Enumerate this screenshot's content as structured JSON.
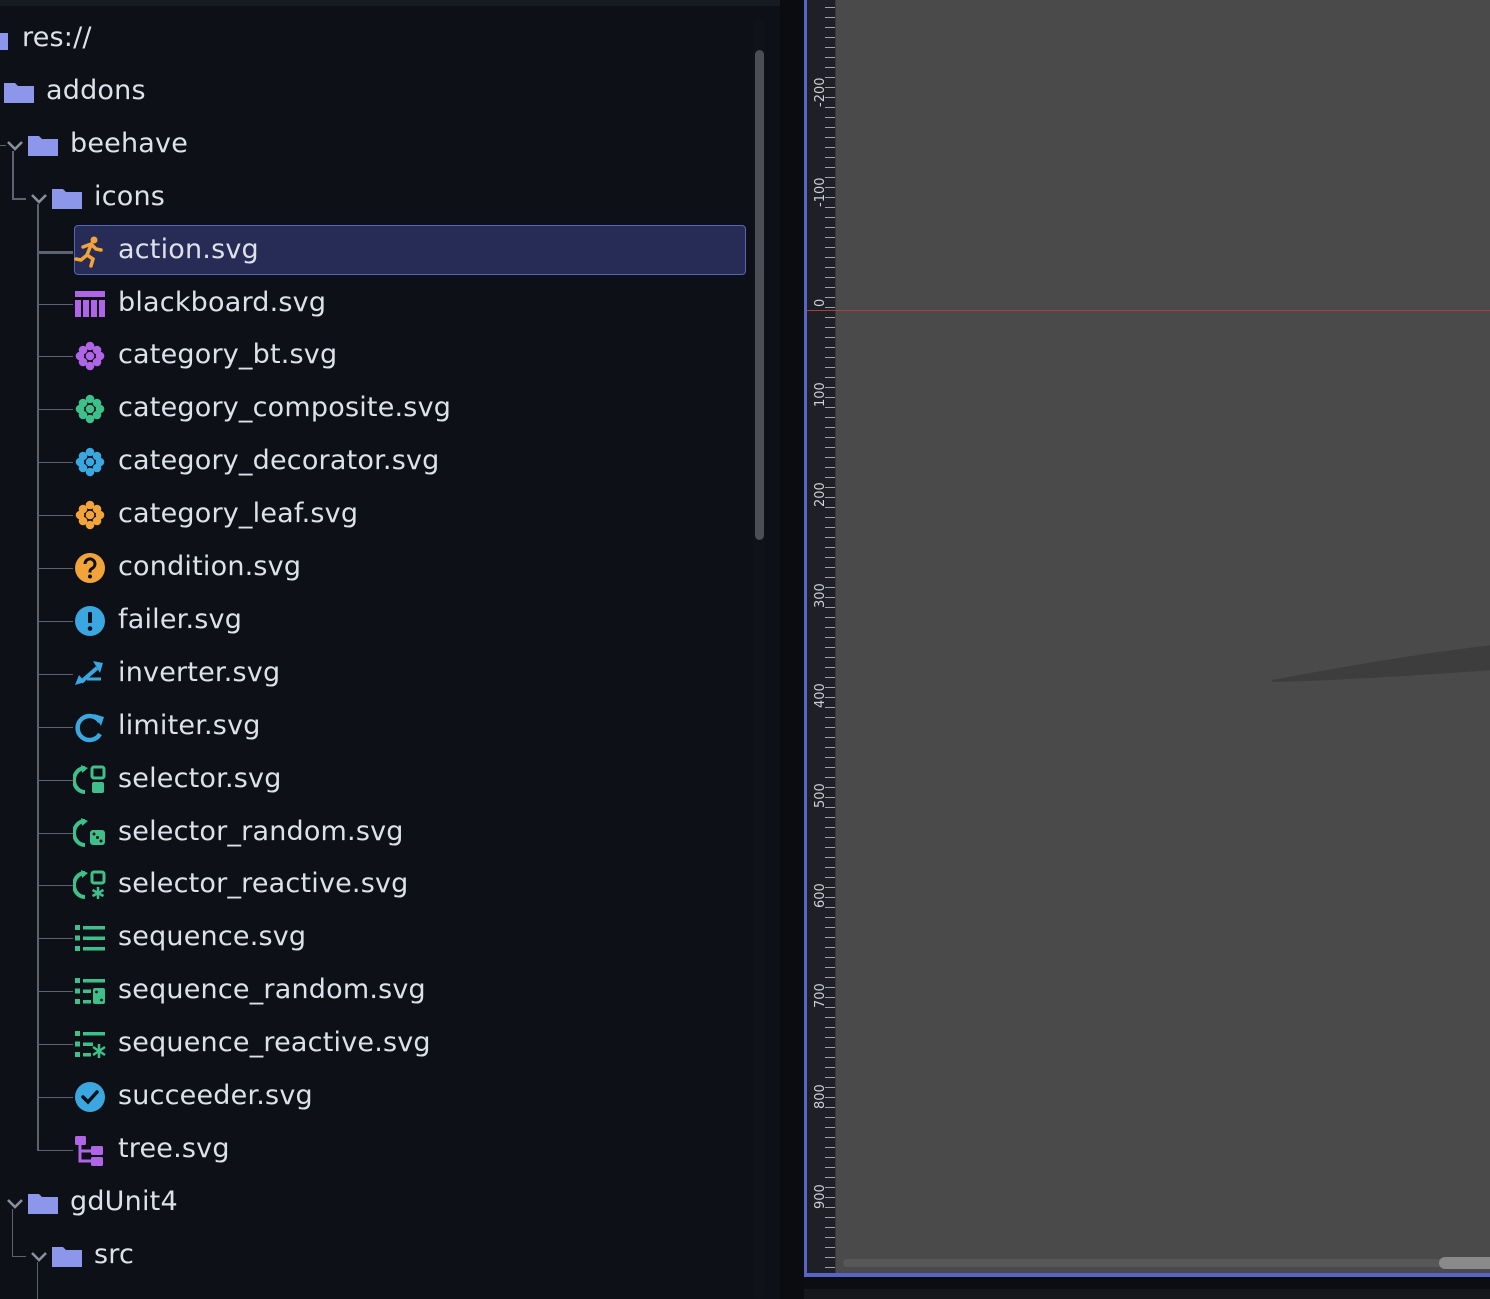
{
  "file_tree": {
    "root": {
      "label": "res://",
      "icon": "folder-icon"
    },
    "items": [
      {
        "label": "addons",
        "icon": "folder-icon",
        "type": "folder"
      },
      {
        "label": "beehave",
        "icon": "folder-icon",
        "type": "folder",
        "expanded": true
      },
      {
        "label": "icons",
        "icon": "folder-icon",
        "type": "folder",
        "expanded": true
      },
      {
        "label": "action.svg",
        "icon": "action-runner-icon",
        "type": "file",
        "color": "#f2a43a",
        "selected": true
      },
      {
        "label": "blackboard.svg",
        "icon": "blackboard-icon",
        "type": "file",
        "color": "#b065e6"
      },
      {
        "label": "category_bt.svg",
        "icon": "category-bt-icon",
        "type": "file",
        "color": "#b065e6"
      },
      {
        "label": "category_composite.svg",
        "icon": "category-composite-icon",
        "type": "file",
        "color": "#3fc08a"
      },
      {
        "label": "category_decorator.svg",
        "icon": "category-decorator-icon",
        "type": "file",
        "color": "#3aa7e0"
      },
      {
        "label": "category_leaf.svg",
        "icon": "category-leaf-icon",
        "type": "file",
        "color": "#f2a43a"
      },
      {
        "label": "condition.svg",
        "icon": "question-mark-icon",
        "type": "file",
        "color": "#f2a43a"
      },
      {
        "label": "failer.svg",
        "icon": "exclamation-icon",
        "type": "file",
        "color": "#3aa7e0"
      },
      {
        "label": "inverter.svg",
        "icon": "swap-arrows-icon",
        "type": "file",
        "color": "#3aa7e0"
      },
      {
        "label": "limiter.svg",
        "icon": "refresh-arrow-icon",
        "type": "file",
        "color": "#3aa7e0"
      },
      {
        "label": "selector.svg",
        "icon": "selector-icon",
        "type": "file",
        "color": "#3fc08a"
      },
      {
        "label": "selector_random.svg",
        "icon": "selector-random-icon",
        "type": "file",
        "color": "#3fc08a"
      },
      {
        "label": "selector_reactive.svg",
        "icon": "selector-reactive-icon",
        "type": "file",
        "color": "#3fc08a"
      },
      {
        "label": "sequence.svg",
        "icon": "sequence-list-icon",
        "type": "file",
        "color": "#3fc08a"
      },
      {
        "label": "sequence_random.svg",
        "icon": "sequence-random-icon",
        "type": "file",
        "color": "#3fc08a"
      },
      {
        "label": "sequence_reactive.svg",
        "icon": "sequence-reactive-icon",
        "type": "file",
        "color": "#3fc08a"
      },
      {
        "label": "succeeder.svg",
        "icon": "check-circle-icon",
        "type": "file",
        "color": "#3aa7e0"
      },
      {
        "label": "tree.svg",
        "icon": "tree-icon",
        "type": "file",
        "color": "#b065e6"
      },
      {
        "label": "gdUnit4",
        "icon": "folder-icon",
        "type": "folder",
        "expanded": true
      },
      {
        "label": "src",
        "icon": "folder-icon",
        "type": "folder",
        "expanded": true
      }
    ]
  },
  "viewport": {
    "ruler_labels": [
      "-200",
      "-100",
      "0",
      "100",
      "200",
      "300",
      "400",
      "500",
      "600",
      "700",
      "800",
      "900"
    ],
    "origin_line_color": "#c0353a",
    "accent_color": "#5865c7"
  },
  "colors": {
    "folder": "#8c96ea",
    "selection_bg": "#262c56",
    "selection_border": "#5865b6"
  }
}
